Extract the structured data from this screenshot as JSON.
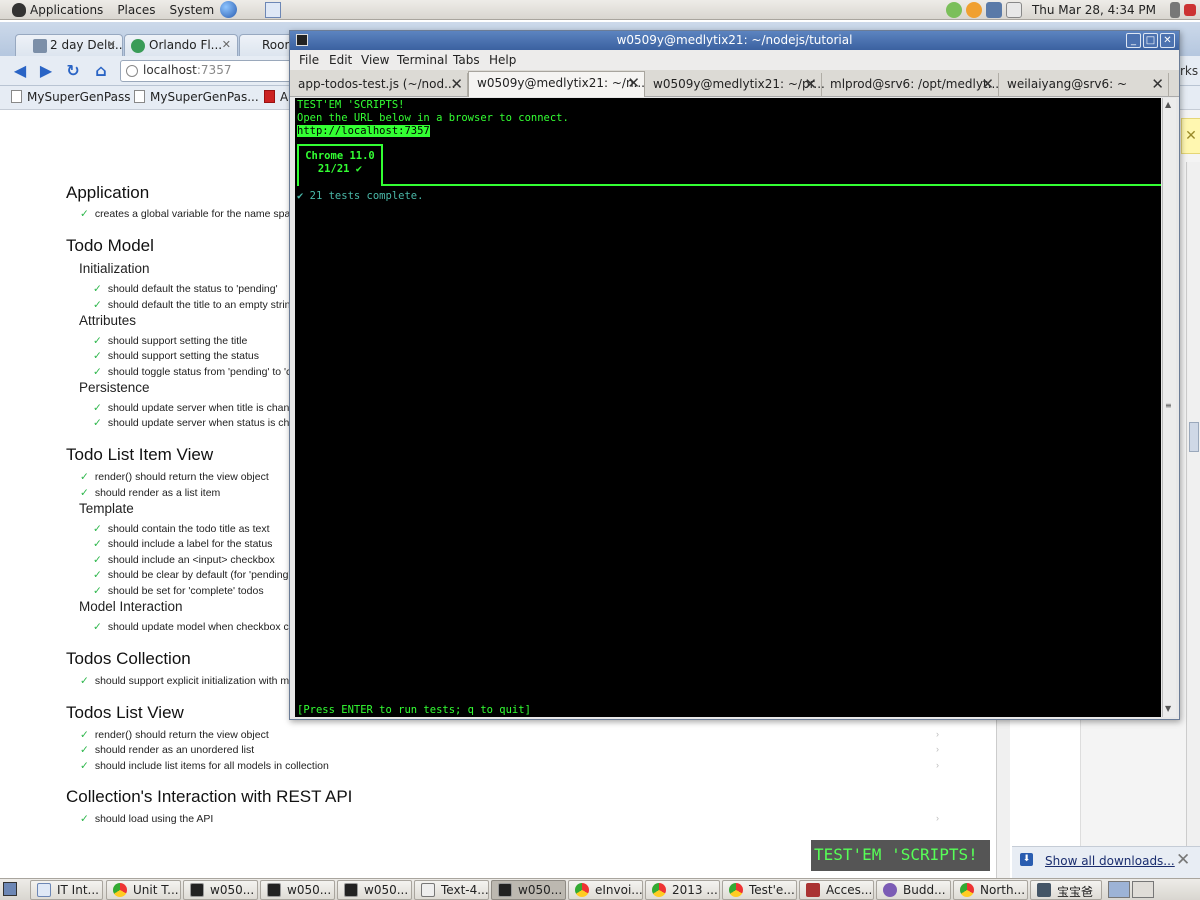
{
  "top_panel": {
    "menus": [
      "Applications",
      "Places",
      "System"
    ],
    "clock": "Thu Mar 28,  4:34 PM"
  },
  "browser": {
    "tabs": [
      "2 day Delu...",
      "Orlando Fl...",
      "Room"
    ],
    "url_host": "localhost",
    "url_port": ":7357",
    "bookmarks": [
      "MySuperGenPass",
      "MySuperGenPas...",
      "A"
    ],
    "downloads_link": "Show all downloads...",
    "right_partial": "rks"
  },
  "test_results": {
    "sections": [
      {
        "title": "Application",
        "tests": [
          "creates a global variable for the name spa"
        ]
      },
      {
        "title": "Todo Model",
        "groups": [
          {
            "title": "Initialization",
            "tests": [
              "should default the status to 'pending'",
              "should default the title to an empty string"
            ]
          },
          {
            "title": "Attributes",
            "tests": [
              "should support setting the title",
              "should support setting the status",
              "should toggle status from 'pending' to 'c"
            ]
          },
          {
            "title": "Persistence",
            "tests": [
              "should update server when title is chan",
              "should update server when status is ch"
            ]
          }
        ]
      },
      {
        "title": "Todo List Item View",
        "tests": [
          "render() should return the view object",
          "should render as a list item"
        ],
        "groups": [
          {
            "title": "Template",
            "tests": [
              "should contain the todo title as text",
              "should include a label for the status",
              "should include an <input> checkbox",
              "should be clear by default (for 'pending'",
              "should be set for 'complete' todos"
            ]
          },
          {
            "title": "Model Interaction",
            "tests": [
              "should update model when checkbox cl"
            ]
          }
        ]
      },
      {
        "title": "Todos Collection",
        "tests": [
          "should support explicit initialization with m"
        ]
      },
      {
        "title": "Todos List View",
        "tests": [
          "render() should return the view object",
          "should render as an unordered list",
          "should include list items for all models in collection"
        ]
      },
      {
        "title": "Collection's Interaction with REST API",
        "tests": [
          "should load using the API"
        ]
      }
    ],
    "check": "✓",
    "pass_marker": "›",
    "badge": "TEST'EM 'SCRIPTS!"
  },
  "terminal": {
    "title": "w0509y@medlytix21: ~/nodejs/tutorial",
    "menu": [
      "File",
      "Edit",
      "View",
      "Terminal",
      "Tabs",
      "Help"
    ],
    "tabs": [
      {
        "label": "app-todos-test.js (~/nod...",
        "active": false
      },
      {
        "label": "w0509y@medlytix21: ~/n...",
        "active": true
      },
      {
        "label": "w0509y@medlytix21: ~/pr...",
        "active": false
      },
      {
        "label": "mlprod@srv6: /opt/medlyt...",
        "active": false
      },
      {
        "label": "weilaiyang@srv6: ~",
        "active": false
      }
    ],
    "screen": {
      "line1": "TEST'EM 'SCRIPTS!",
      "line2": "Open the URL below in a browser to connect.",
      "url": "http://localhost:7357",
      "browser_name": "Chrome 11.0",
      "browser_result": "21/21 ✔",
      "complete": "✔ 21 tests complete.",
      "prompt": "[Press ENTER to run tests; q to quit]"
    }
  },
  "taskbar": {
    "tasks": [
      {
        "label": "IT Int...",
        "icon": "doc-icon"
      },
      {
        "label": "Unit T...",
        "icon": "chrome-icon"
      },
      {
        "label": "w050...",
        "icon": "terminal-icon"
      },
      {
        "label": "w050...",
        "icon": "terminal-icon"
      },
      {
        "label": "w050...",
        "icon": "terminal-icon"
      },
      {
        "label": "Text-4...",
        "icon": "text-editor-icon"
      },
      {
        "label": "w050...",
        "icon": "terminal-icon",
        "active": true
      },
      {
        "label": "eInvoi...",
        "icon": "chrome-icon"
      },
      {
        "label": "2013 ...",
        "icon": "chrome-icon"
      },
      {
        "label": "Test'e...",
        "icon": "chrome-icon"
      },
      {
        "label": "Acces...",
        "icon": "access-icon"
      },
      {
        "label": "Budd...",
        "icon": "buddy-icon"
      },
      {
        "label": "North...",
        "icon": "chrome-icon"
      },
      {
        "label": "宝宝爸",
        "icon": "photo-icon"
      }
    ]
  }
}
